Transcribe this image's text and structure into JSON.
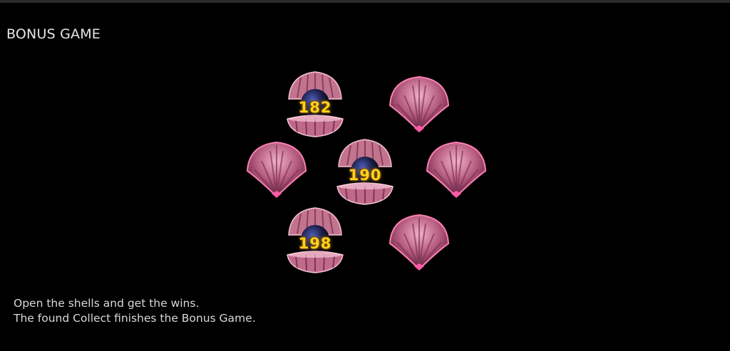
{
  "header": {
    "title": "BONUS GAME"
  },
  "shells": [
    {
      "state": "open",
      "value": "182"
    },
    {
      "state": "closed",
      "value": ""
    },
    {
      "state": "closed",
      "value": ""
    },
    {
      "state": "open",
      "value": "190"
    },
    {
      "state": "closed",
      "value": ""
    },
    {
      "state": "open",
      "value": "198"
    },
    {
      "state": "closed",
      "value": ""
    }
  ],
  "instructions": {
    "line1": "Open the shells and get the wins.",
    "line2": "The found Collect finishes the Bonus Game."
  },
  "colors": {
    "background": "#000000",
    "shell_pink": "#c8708f",
    "shell_glow": "#ff4fa0",
    "pearl": "#1b1f48",
    "win_gold": "#ffd21a"
  }
}
